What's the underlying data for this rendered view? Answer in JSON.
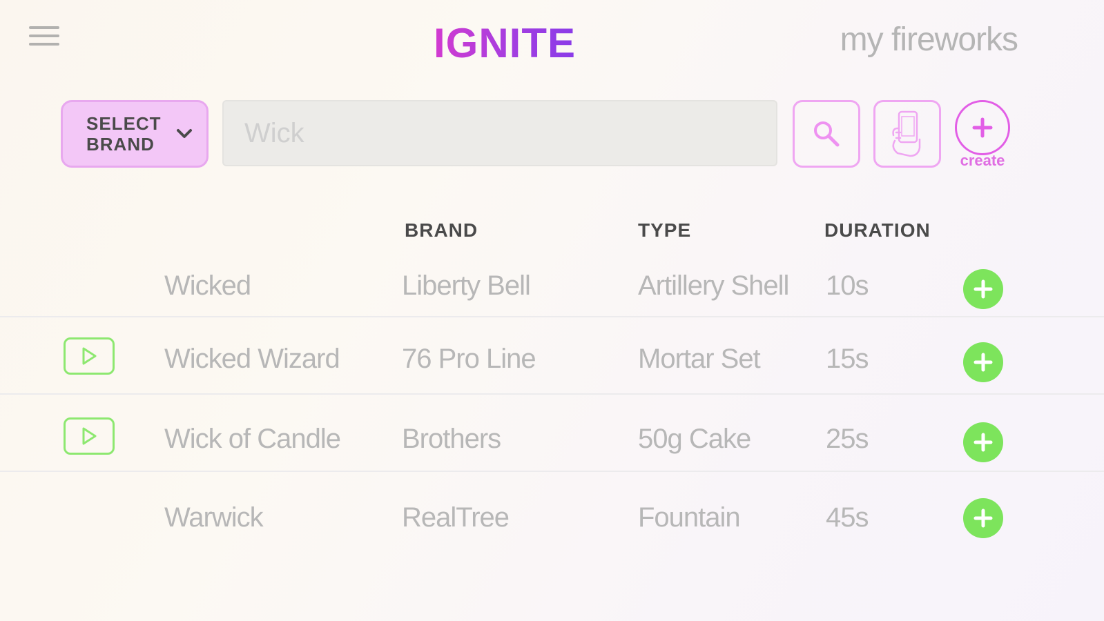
{
  "header": {
    "logo_text": "IGNITE",
    "my_fireworks_link": "my fireworks"
  },
  "toolbar": {
    "brand_select_label": "SELECT\nBRAND",
    "search_value": "",
    "search_placeholder": "Wick",
    "create_label": "create"
  },
  "table": {
    "columns": [
      "BRAND",
      "TYPE",
      "DURATION"
    ],
    "rows": [
      {
        "name": "Wicked",
        "brand": "Liberty Bell",
        "type": "Artillery Shell",
        "duration": "10s",
        "has_video": false
      },
      {
        "name": "Wicked Wizard",
        "brand": "76 Pro Line",
        "type": "Mortar Set",
        "duration": "15s",
        "has_video": true
      },
      {
        "name": "Wick of Candle",
        "brand": "Brothers",
        "type": "50g Cake",
        "duration": "25s",
        "has_video": true
      },
      {
        "name": "Warwick",
        "brand": "RealTree",
        "type": "Fountain",
        "duration": "45s",
        "has_video": false
      }
    ]
  },
  "colors": {
    "accent_pink": "#ef9ff2",
    "brand_select_bg": "#f3c7f7",
    "add_green": "#7de45c",
    "play_green": "#8de870"
  },
  "icons": [
    "menu-icon",
    "chevron-down-icon",
    "search-icon",
    "phone-scan-icon",
    "plus-icon",
    "play-icon"
  ]
}
